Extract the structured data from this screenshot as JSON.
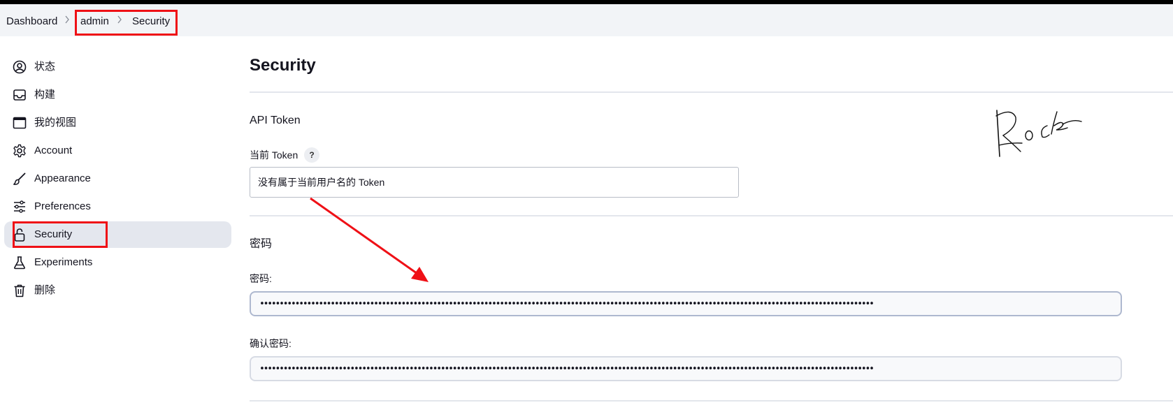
{
  "breadcrumb": {
    "items": [
      "Dashboard",
      "admin",
      "Security"
    ]
  },
  "sidebar": {
    "items": [
      {
        "label": "状态",
        "icon": "user-circle-icon"
      },
      {
        "label": "构建",
        "icon": "inbox-icon"
      },
      {
        "label": "我的视图",
        "icon": "window-icon"
      },
      {
        "label": "Account",
        "icon": "gear-icon"
      },
      {
        "label": "Appearance",
        "icon": "brush-icon"
      },
      {
        "label": "Preferences",
        "icon": "sliders-icon"
      },
      {
        "label": "Security",
        "icon": "lock-icon",
        "active": true
      },
      {
        "label": "Experiments",
        "icon": "flask-icon"
      },
      {
        "label": "删除",
        "icon": "trash-icon"
      }
    ]
  },
  "main": {
    "title": "Security",
    "api_token": {
      "section_title": "API Token",
      "current_token_label": "当前 Token",
      "help_label": "?",
      "token_value": "没有属于当前用户名的 Token"
    },
    "password": {
      "section_title": "密码",
      "password_label": "密码:",
      "password_value": "••••••••••••••••••••••••••••••••••••••••••••••••••••••••••••••••••••••••••••••••••••••••••••••••••••••••••••••••••••••••••••••••••••••••••••••••••••••••••••",
      "confirm_label": "确认密码:",
      "confirm_value": "••••••••••••••••••••••••••••••••••••••••••••••••••••••••••••••••••••••••••••••••••••••••••••••••••••••••••••••••••••••••••••••••••••••••••••••••••••••••••••"
    }
  },
  "annotations": {
    "highlight_color": "#ef1016",
    "signature_text": "Rock"
  }
}
